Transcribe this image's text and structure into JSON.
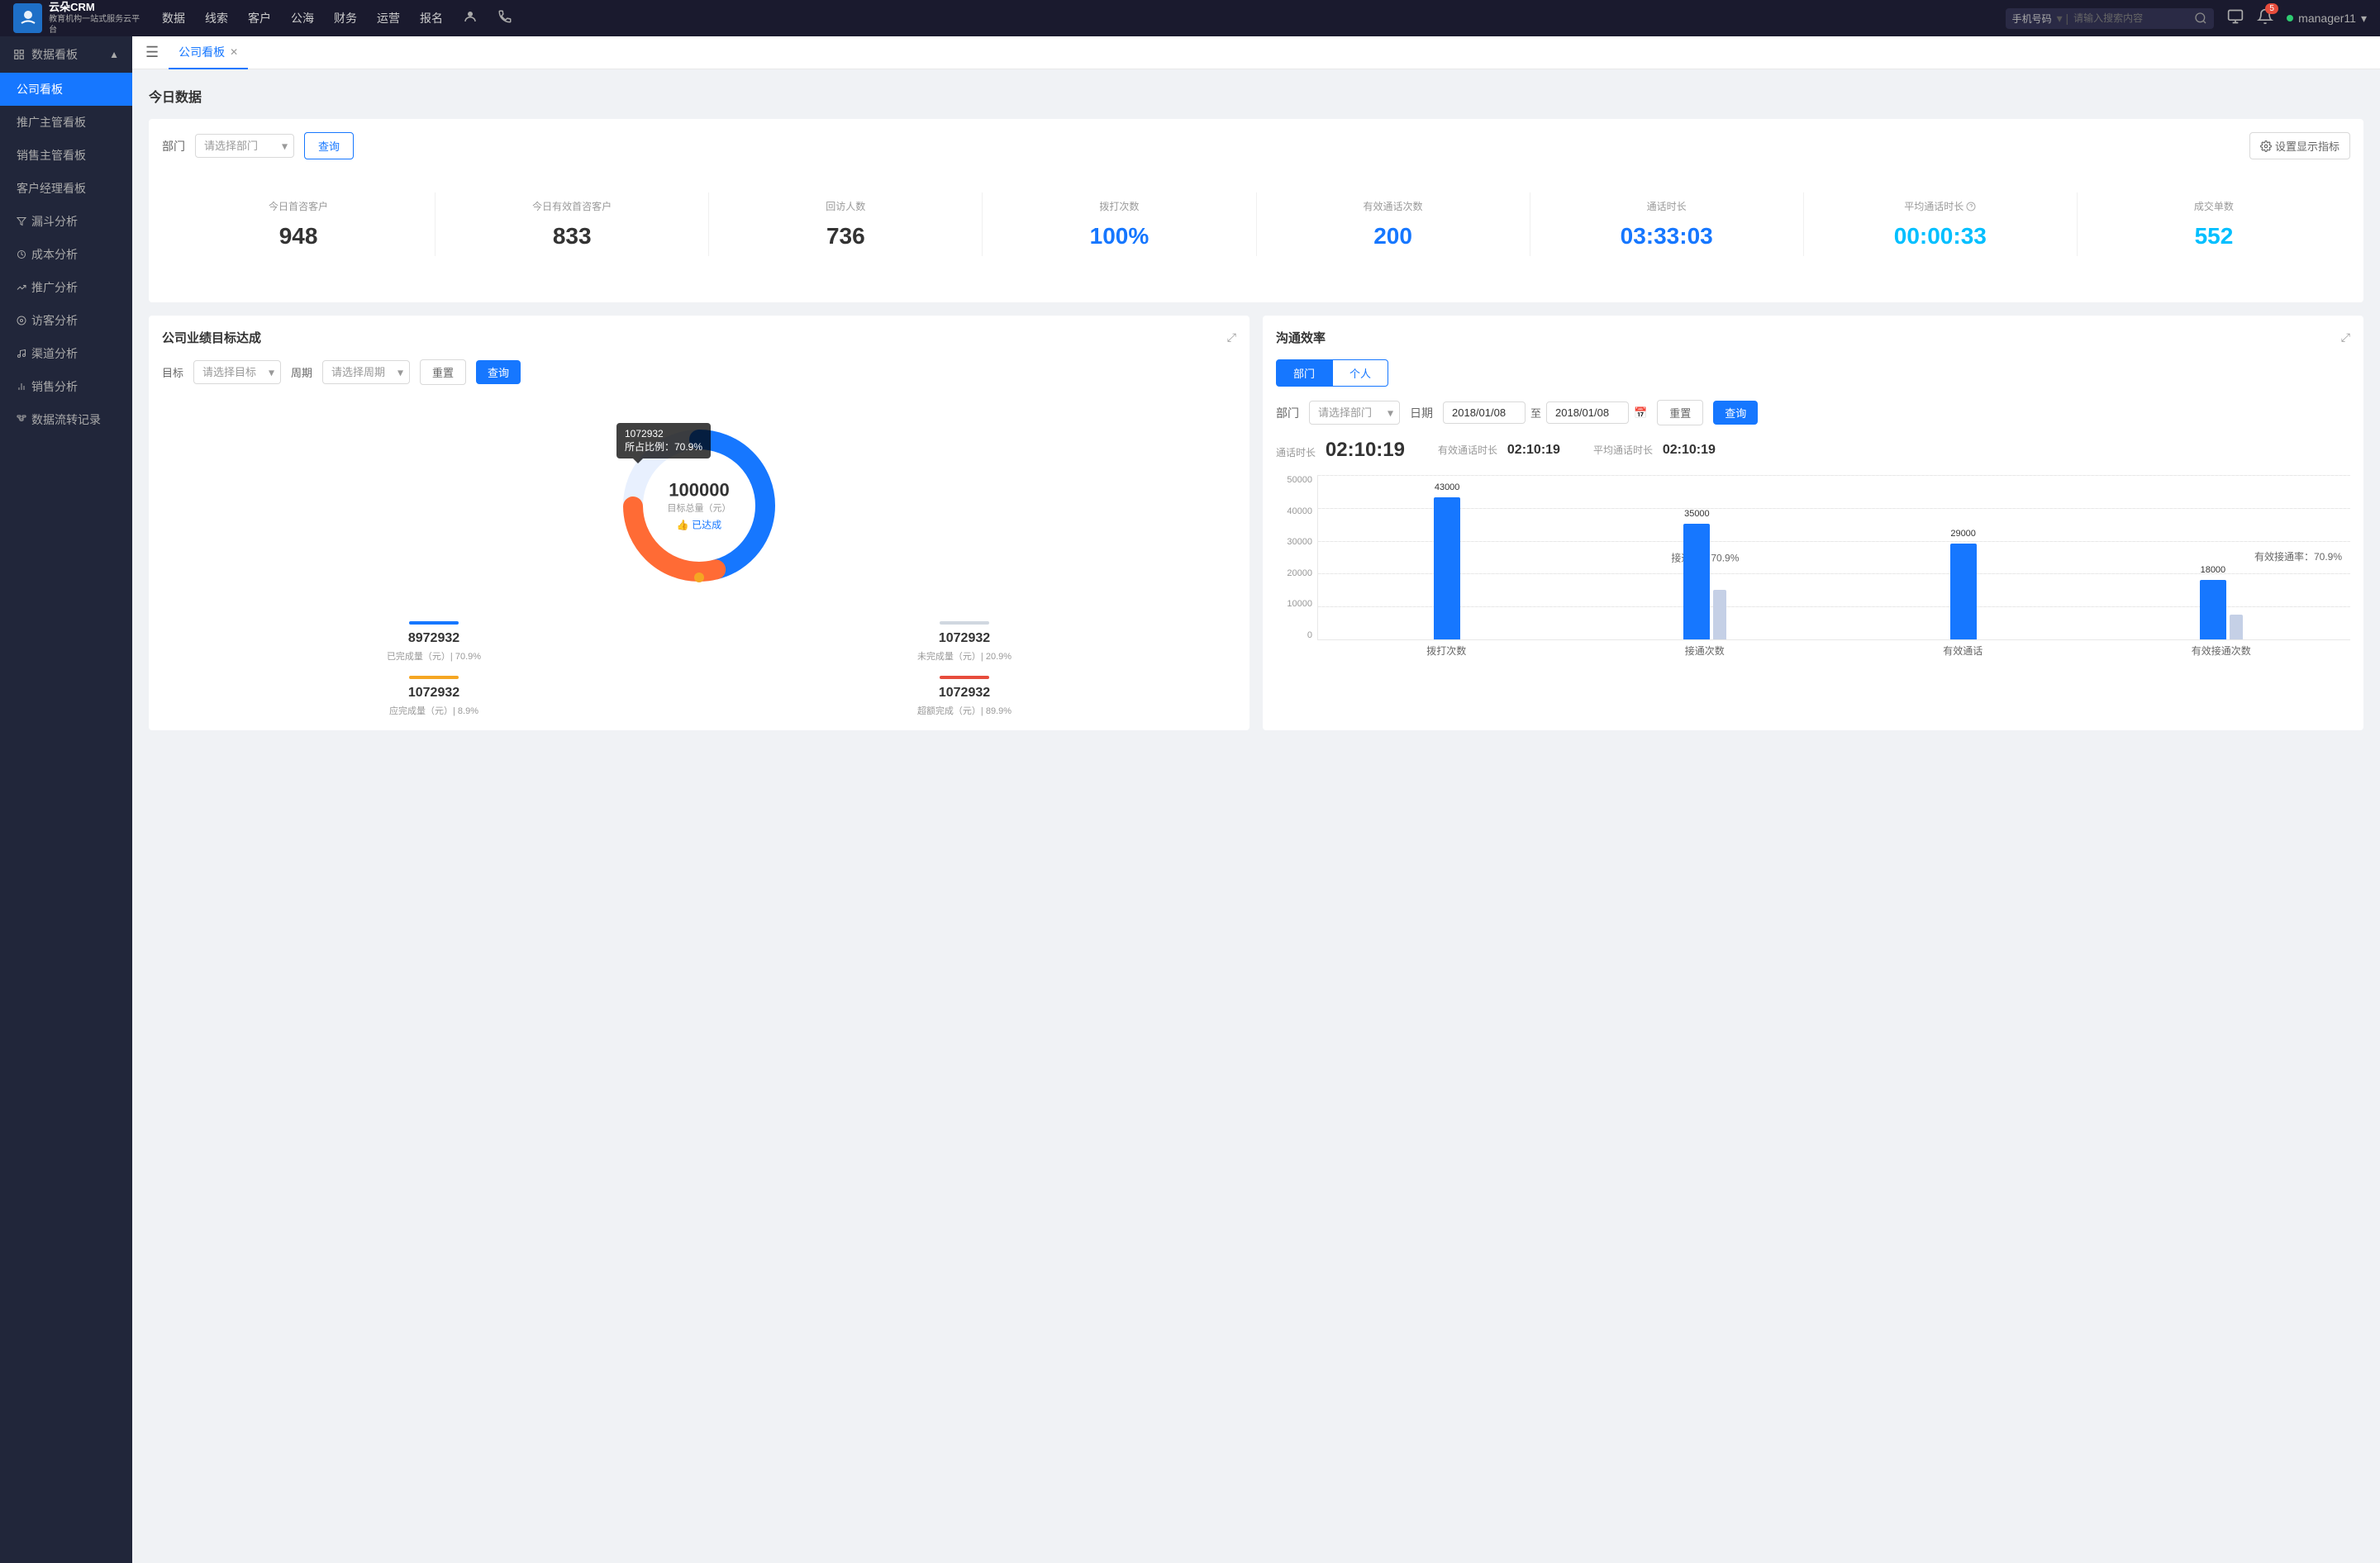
{
  "app": {
    "logo_text_line1": "云朵CRM",
    "logo_text_line2": "教育机构一站式服务云平台"
  },
  "top_nav": {
    "items": [
      {
        "label": "数据"
      },
      {
        "label": "线索"
      },
      {
        "label": "客户"
      },
      {
        "label": "公海"
      },
      {
        "label": "财务"
      },
      {
        "label": "运营"
      },
      {
        "label": "报名"
      }
    ],
    "search_placeholder": "请输入搜索内容",
    "search_select": "手机号码",
    "notification_count": "5",
    "user_name": "manager11"
  },
  "sidebar": {
    "section_label": "数据看板",
    "items": [
      {
        "label": "公司看板",
        "active": true
      },
      {
        "label": "推广主管看板",
        "active": false
      },
      {
        "label": "销售主管看板",
        "active": false
      },
      {
        "label": "客户经理看板",
        "active": false
      },
      {
        "label": "漏斗分析",
        "active": false
      },
      {
        "label": "成本分析",
        "active": false
      },
      {
        "label": "推广分析",
        "active": false
      },
      {
        "label": "访客分析",
        "active": false
      },
      {
        "label": "渠道分析",
        "active": false
      },
      {
        "label": "销售分析",
        "active": false
      },
      {
        "label": "数据流转记录",
        "active": false
      }
    ]
  },
  "tab_bar": {
    "tab_label": "公司看板"
  },
  "today_data": {
    "section_title": "今日数据",
    "filter_label": "部门",
    "select_placeholder": "请选择部门",
    "btn_query": "查询",
    "btn_settings": "设置显示指标",
    "stats": [
      {
        "label": "今日首咨客户",
        "value": "948",
        "color": "dark"
      },
      {
        "label": "今日有效首咨客户",
        "value": "833",
        "color": "dark"
      },
      {
        "label": "回访人数",
        "value": "736",
        "color": "dark"
      },
      {
        "label": "拨打次数",
        "value": "100%",
        "color": "blue"
      },
      {
        "label": "有效通话次数",
        "value": "200",
        "color": "blue"
      },
      {
        "label": "通话时长",
        "value": "03:33:03",
        "color": "blue"
      },
      {
        "label": "平均通话时长",
        "value": "00:00:33",
        "color": "cyan"
      },
      {
        "label": "成交单数",
        "value": "552",
        "color": "cyan"
      }
    ]
  },
  "company_goal": {
    "card_title": "公司业绩目标达成",
    "filter_target_label": "目标",
    "filter_target_placeholder": "请选择目标",
    "filter_period_label": "周期",
    "filter_period_placeholder": "请选择周期",
    "btn_reset": "重置",
    "btn_query": "查询",
    "donut": {
      "total": "100000",
      "unit_label": "目标总量（元）",
      "status_label": "👍 已达成",
      "tooltip_value": "1072932",
      "tooltip_ratio": "所占比例：70.9%"
    },
    "goal_stats": [
      {
        "bar_color": "bar-blue",
        "value": "8972932",
        "desc": "已完成量（元）| 70.9%"
      },
      {
        "bar_color": "bar-gray",
        "value": "1072932",
        "desc": "未完成量（元）| 20.9%"
      },
      {
        "bar_color": "bar-orange",
        "value": "1072932",
        "desc": "应完成量（元）| 8.9%"
      },
      {
        "bar_color": "bar-red",
        "value": "1072932",
        "desc": "超额完成（元）| 89.9%"
      }
    ]
  },
  "communication": {
    "card_title": "沟通效率",
    "tab_dept": "部门",
    "tab_personal": "个人",
    "active_tab": "部门",
    "filter_dept_label": "部门",
    "filter_dept_placeholder": "请选择部门",
    "filter_date_label": "日期",
    "date_start": "2018/01/08",
    "date_end": "2018/01/08",
    "btn_reset": "重置",
    "btn_query": "查询",
    "stats": [
      {
        "label": "通话时长",
        "value": "02:10:19"
      },
      {
        "label": "有效通话时长",
        "value": "02:10:19"
      },
      {
        "label": "平均通话时长",
        "value": "02:10:19"
      }
    ],
    "chart": {
      "y_labels": [
        "50000",
        "40000",
        "30000",
        "20000",
        "10000",
        "0"
      ],
      "groups": [
        {
          "label": "拨打次数",
          "bar1_value": 43000,
          "bar1_label": "43000",
          "bar2_value": 0,
          "bar2_label": "",
          "rate_label": "",
          "rate_value": ""
        },
        {
          "label": "接通次数",
          "bar1_value": 35000,
          "bar1_label": "35000",
          "bar2_value": 0,
          "bar2_label": "",
          "rate_label": "接通率：",
          "rate_value": "70.9%"
        },
        {
          "label": "有效通话",
          "bar1_value": 29000,
          "bar1_label": "29000",
          "bar2_value": 0,
          "bar2_label": "",
          "rate_label": "",
          "rate_value": ""
        },
        {
          "label": "有效接通次数",
          "bar1_value": 18000,
          "bar1_label": "18000",
          "bar2_value": 5000,
          "bar2_label": "",
          "rate_label": "有效接通率：",
          "rate_value": "70.9%"
        }
      ]
    }
  }
}
